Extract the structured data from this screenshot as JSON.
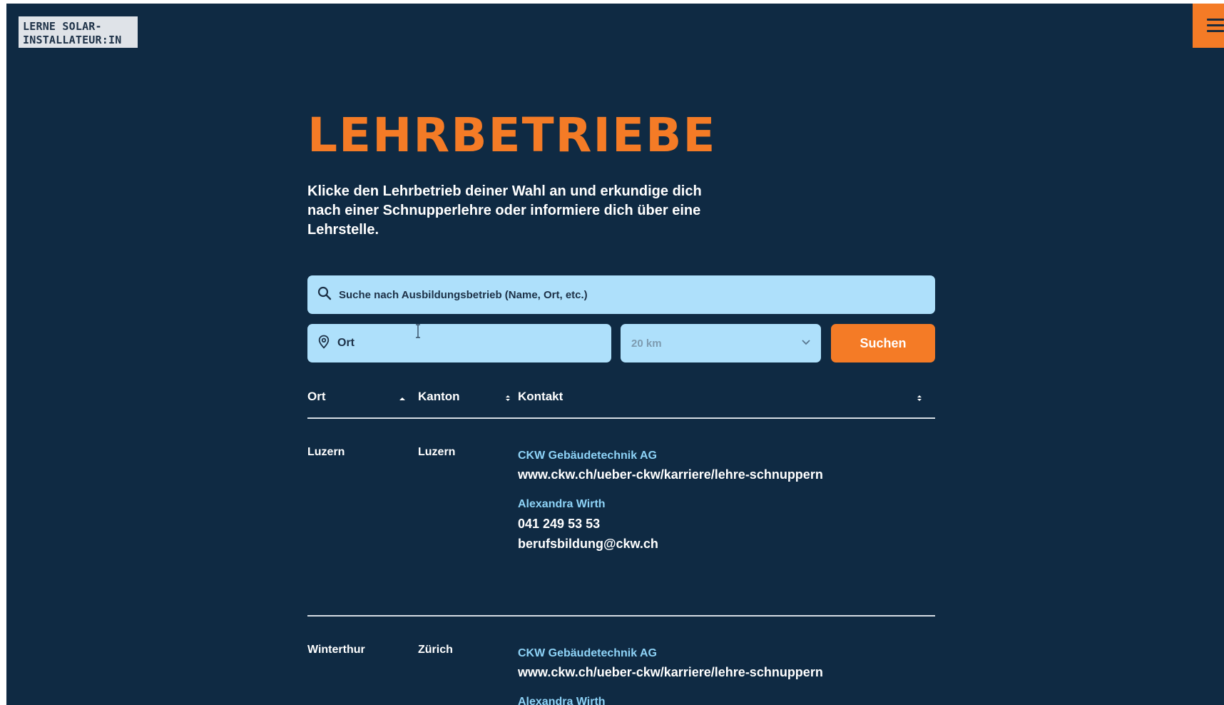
{
  "logo": {
    "line1": "LERNE SOLAR-",
    "line2": "INSTALLATEUR:IN"
  },
  "menu_icon": "hamburger-menu-icon",
  "page": {
    "title": "LEHRBETRIEBE",
    "intro": "Klicke den Lehrbetrieb deiner Wahl an und erkundige dich nach einer Schnupperlehre oder informiere dich über eine Lehrstelle."
  },
  "search": {
    "placeholder": "Suche nach Ausbildungsbetrieb (Name, Ort, etc.)",
    "icon": "search-icon"
  },
  "filters": {
    "location_value": "Ort",
    "location_icon": "location-pin-icon",
    "radius_value": "20 km",
    "submit_label": "Suchen"
  },
  "table": {
    "headers": {
      "ort": "Ort",
      "kanton": "Kanton",
      "kontakt": "Kontakt"
    },
    "rows": [
      {
        "ort": "Luzern",
        "kanton": "Luzern",
        "company": "CKW Gebäudetechnik AG",
        "url": "www.ckw.ch/ueber-ckw/karriere/lehre-schnuppern",
        "person": "Alexandra Wirth",
        "phone": "041 249 53 53",
        "email": "berufsbildung@ckw.ch"
      },
      {
        "ort": "Winterthur",
        "kanton": "Zürich",
        "company": "CKW Gebäudetechnik AG",
        "url": "www.ckw.ch/ueber-ckw/karriere/lehre-schnuppern",
        "person": "Alexandra Wirth"
      }
    ]
  },
  "colors": {
    "background": "#0f2a43",
    "accent": "#f47b26",
    "input_bg": "#aee0fb",
    "link": "#8ed3f7"
  }
}
